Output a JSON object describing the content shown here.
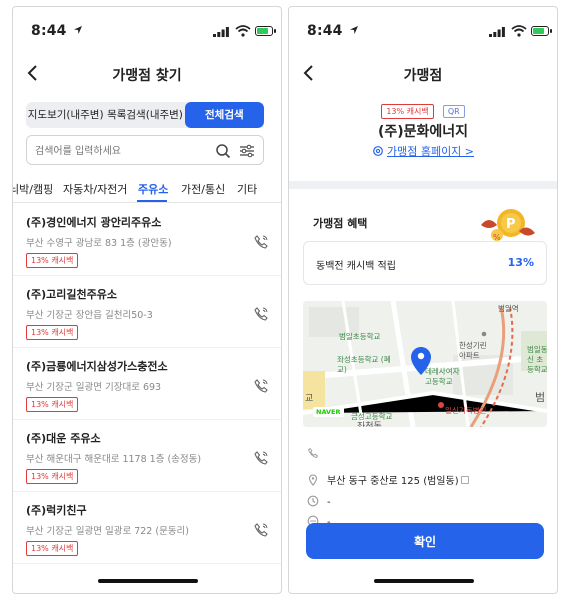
{
  "status_bar": {
    "time": "8:44"
  },
  "left": {
    "title": "가맹점 찾기",
    "segments": [
      "지도보기(내주변)",
      "목록검색(내주변)",
      "전체검색"
    ],
    "active_segment": 2,
    "search_placeholder": "검색어를 입력하세요",
    "categories": [
      "늬박/캠핑",
      "자동차/자전거",
      "주유소",
      "가전/통신",
      "기타"
    ],
    "active_category": "주유소",
    "items": [
      {
        "name": "(주)경인에너지 광안리주유소",
        "address": "부산 수영구 광남로 83 1층 (광안동)",
        "badge": "13% 캐시백"
      },
      {
        "name": "(주)고리길천주유소",
        "address": "부산 기장군 장안읍 길천리50-3",
        "badge": "13% 캐시백"
      },
      {
        "name": "(주)금룡에너지삼성가스충전소",
        "address": "부산 기장군 일광면 기장대로 693",
        "badge": "13% 캐시백"
      },
      {
        "name": "(주)대운 주유소",
        "address": "부산 해운대구 해운대로 1178 1층 (송정동)",
        "badge": "13% 캐시백"
      },
      {
        "name": "(주)럭키친구",
        "address": "부산 기장군 일광면 일광로 722 (문동리)",
        "badge": "13% 캐시백"
      }
    ]
  },
  "right": {
    "title": "가맹점",
    "tag_cashback": "13% 캐시백",
    "tag_qr": "QR",
    "store_name": "(주)문화에너지",
    "homepage_link": "가맹점 홈페이지 >",
    "benefit_title": "가맹점 혜택",
    "benefit_label": "동백전 캐시백 적립",
    "benefit_value": "13%",
    "map_labels": {
      "station": "범일역",
      "school1": "범일초등학교",
      "school2": "좌성초등학교 (폐교)",
      "apt": "한성기린 아파트",
      "school3": "데레사여자 고등학교",
      "school4": "금성고등학교",
      "hospital": "일신기독병원",
      "school5": "범일동신 초등학교",
      "area": "좌천동",
      "partial1": "교",
      "partial2": "범",
      "naver": "NAVER"
    },
    "phone": "",
    "address": "부산 동구 중산로 125 (범일동)",
    "hours": "-",
    "extra": "-",
    "confirm_label": "확인"
  },
  "colors": {
    "accent": "#2563eb",
    "badge_red": "#e03a3a"
  }
}
